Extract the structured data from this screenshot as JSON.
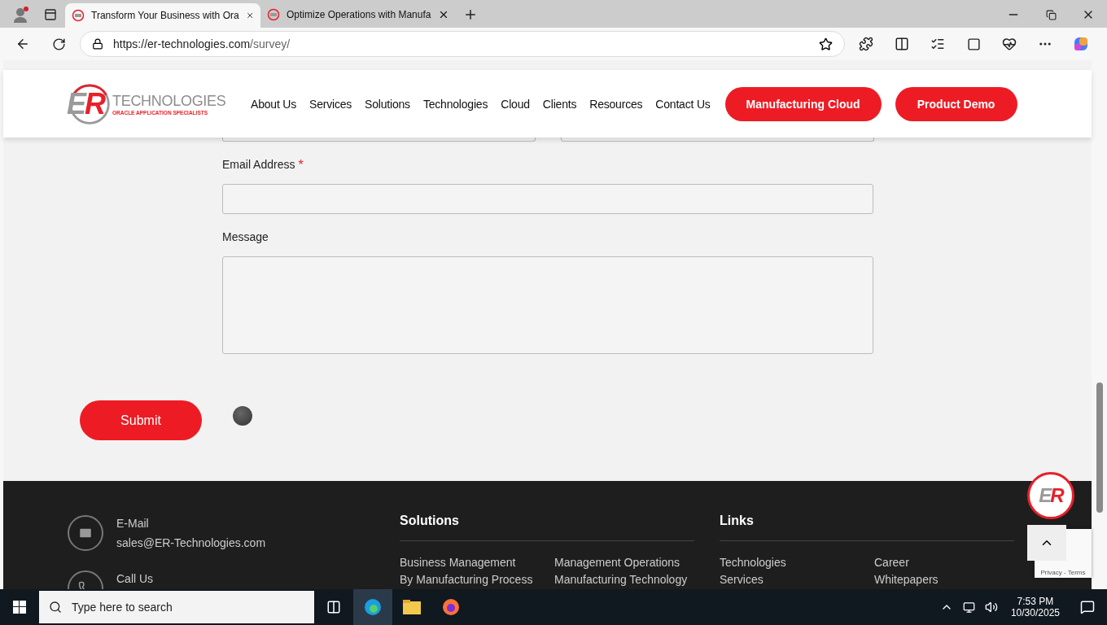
{
  "browser": {
    "tabs": [
      {
        "title": "Transform Your Business with Ora",
        "selected": true
      },
      {
        "title": "Optimize Operations with Manufa",
        "selected": false
      }
    ],
    "url": {
      "host": "https://er-technologies.com",
      "path": "/survey/"
    }
  },
  "header": {
    "logo": {
      "mark_left": "E",
      "mark_right": "R",
      "brand": "TECHNOLOGIES",
      "tagline": "ORACLE APPLICATION SPECIALISTS"
    },
    "nav": [
      "About Us",
      "Services",
      "Solutions",
      "Technologies",
      "Cloud",
      "Clients",
      "Resources",
      "Contact Us"
    ],
    "buttons": [
      "Manufacturing Cloud",
      "Product Demo"
    ]
  },
  "form": {
    "fields": [
      {
        "label": "Email Address",
        "required": true,
        "kind": "input"
      },
      {
        "label": "Message",
        "required": false,
        "kind": "textarea"
      }
    ],
    "required_mark": "*",
    "submit": "Submit"
  },
  "footer": {
    "contacts": [
      {
        "kind": "email",
        "label": "E-Mail",
        "value": "sales@ER-Technologies.com"
      },
      {
        "kind": "phone",
        "label": "Call Us"
      }
    ],
    "columns": [
      {
        "title": "Solutions",
        "links": [
          [
            "Business Management",
            "By Manufacturing Process"
          ],
          [
            "Management Operations",
            "Manufacturing Technology"
          ]
        ]
      },
      {
        "title": "Links",
        "links": [
          [
            "Technologies",
            "Services"
          ],
          [
            "Career",
            "Whitepapers"
          ]
        ]
      }
    ]
  },
  "floating_badge": {
    "mark_left": "E",
    "mark_right": "R"
  },
  "recaptcha": {
    "links": "Privacy - Terms"
  },
  "taskbar": {
    "search_placeholder": "Type here to search",
    "time": "7:53 PM",
    "date": "10/30/2025"
  }
}
